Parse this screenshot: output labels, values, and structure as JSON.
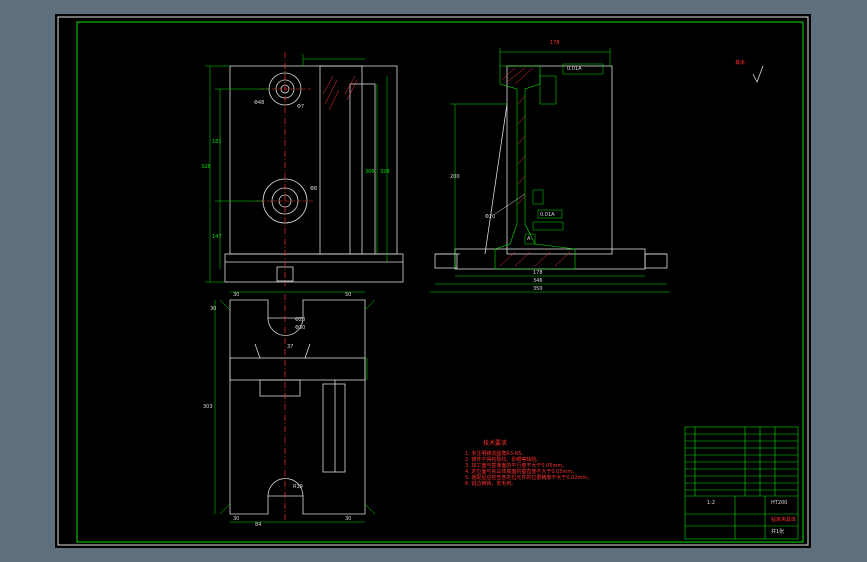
{
  "canvas": {
    "background": "#000000",
    "frame_color": "#5f6f7b",
    "accent_green": "#00e000",
    "accent_red": "#ff3030"
  },
  "drawing": {
    "roughness_mark": "其余",
    "tech_title": "技术要求",
    "tech_notes": [
      "1. 未注明铸造圆角R3-R5。",
      "2. 铸件不得有裂纹、砂眼等缺陷。",
      "3. 加工面与基准面的平行度不大于0.05mm。",
      "4. 定位面与夹具体底面的垂直度不大于0.05mm。",
      "5. 装配后应检查各定位元件的位置精度不大于0.02mm。",
      "6. 锐边倒钝，去毛刺。"
    ],
    "dims_front": {
      "d1": "328",
      "d2": "181",
      "d3": "147",
      "d4": "Φ48",
      "d5": "Φ7",
      "d6": "Φ8",
      "d7": "306",
      "d8": "328"
    },
    "dims_side": {
      "top": "178",
      "h": "200",
      "b1": "178",
      "b2": "346",
      "b3": "350",
      "v1": "Φ20",
      "tol1": "0.01A",
      "tol2": "0.01A",
      "datum": "A"
    },
    "dims_top": {
      "t1": "30",
      "t2": "50",
      "t3": "Φ20",
      "t4": "Φ30",
      "t5": "37",
      "t6": "303",
      "t7": "R19",
      "t8": "30",
      "t9": "84",
      "t10": "30",
      "t11": "30"
    },
    "title_block": {
      "scale": "1:2",
      "name": "钻床夹具体",
      "material": "HT200",
      "sheet": "共1张"
    }
  }
}
